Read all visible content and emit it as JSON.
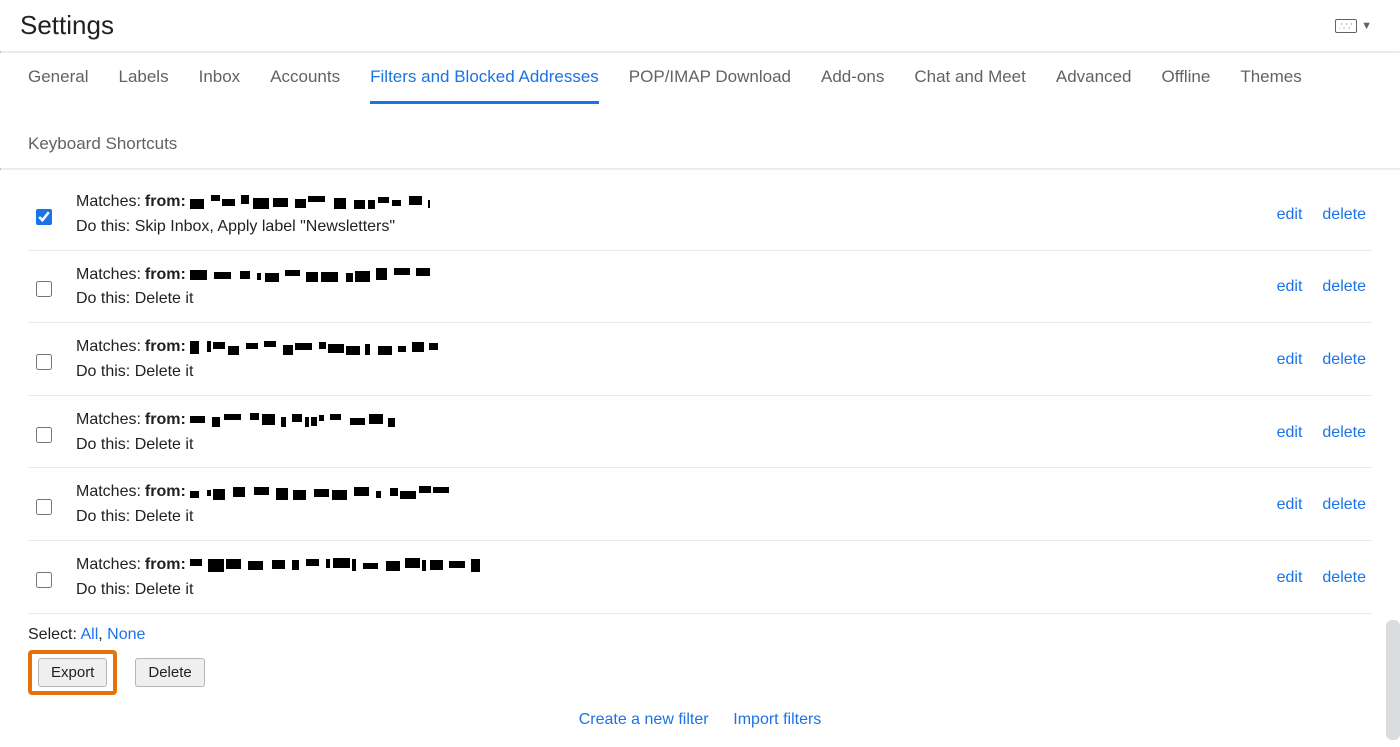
{
  "header": {
    "title": "Settings"
  },
  "tabs": [
    {
      "label": "General",
      "active": false
    },
    {
      "label": "Labels",
      "active": false
    },
    {
      "label": "Inbox",
      "active": false
    },
    {
      "label": "Accounts",
      "active": false
    },
    {
      "label": "Filters and Blocked Addresses",
      "active": true
    },
    {
      "label": "POP/IMAP Download",
      "active": false
    },
    {
      "label": "Add-ons",
      "active": false
    },
    {
      "label": "Chat and Meet",
      "active": false
    },
    {
      "label": "Advanced",
      "active": false
    },
    {
      "label": "Offline",
      "active": false
    },
    {
      "label": "Themes",
      "active": false
    },
    {
      "label": "Keyboard Shortcuts",
      "active": false
    }
  ],
  "labels": {
    "matches_prefix": "Matches: ",
    "from_prefix": "from:",
    "do_this_prefix": "Do this: ",
    "edit": "edit",
    "delete_link": "delete",
    "select_prefix": "Select: ",
    "select_all": "All",
    "select_sep": ", ",
    "select_none": "None",
    "export_btn": "Export",
    "delete_btn": "Delete",
    "create_filter": "Create a new filter",
    "import_filters": "Import filters"
  },
  "filters": [
    {
      "checked": true,
      "action": "Skip Inbox, Apply label \"Newsletters\"",
      "redact_w": 240
    },
    {
      "checked": false,
      "action": "Delete it",
      "redact_w": 240
    },
    {
      "checked": false,
      "action": "Delete it",
      "redact_w": 255
    },
    {
      "checked": false,
      "action": "Delete it",
      "redact_w": 205
    },
    {
      "checked": false,
      "action": "Delete it",
      "redact_w": 260
    },
    {
      "checked": false,
      "action": "Delete it",
      "redact_w": 290
    }
  ]
}
